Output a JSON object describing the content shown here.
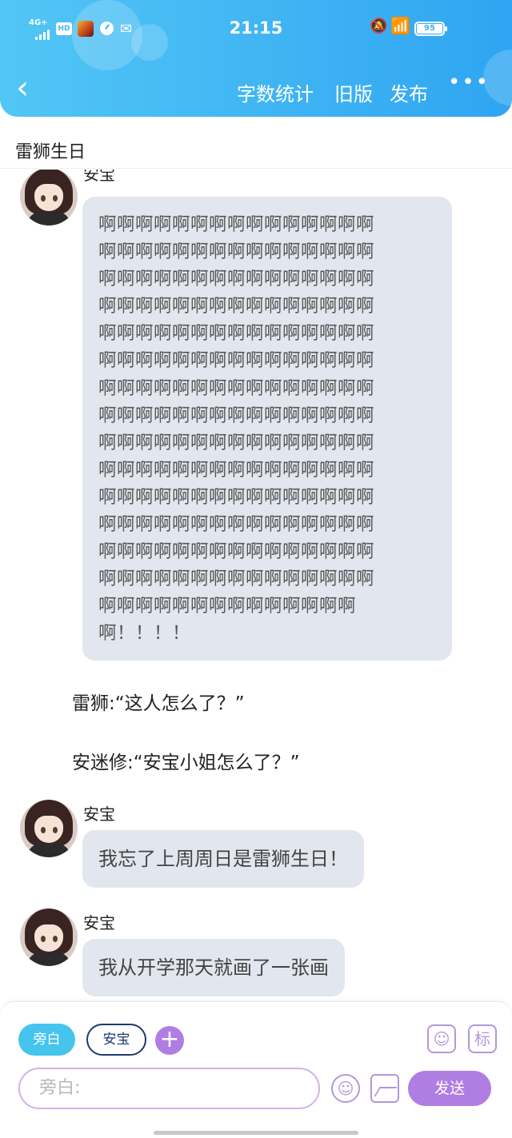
{
  "status_bar": {
    "network": "4G+",
    "hd": "HD",
    "time": "21:15",
    "battery": "95"
  },
  "toolbar": {
    "back_label": "‹",
    "word_count": "字数统计",
    "old_version": "旧版",
    "publish": "发布",
    "more": "•••"
  },
  "doc": {
    "title": "雷狮生日"
  },
  "messages": {
    "first": {
      "speaker": "安宝",
      "lines": [
        "啊啊啊啊啊啊啊啊啊啊啊啊啊啊啊",
        "啊啊啊啊啊啊啊啊啊啊啊啊啊啊啊",
        "啊啊啊啊啊啊啊啊啊啊啊啊啊啊啊",
        "啊啊啊啊啊啊啊啊啊啊啊啊啊啊啊",
        "啊啊啊啊啊啊啊啊啊啊啊啊啊啊啊",
        "啊啊啊啊啊啊啊啊啊啊啊啊啊啊啊",
        "啊啊啊啊啊啊啊啊啊啊啊啊啊啊啊",
        "啊啊啊啊啊啊啊啊啊啊啊啊啊啊啊",
        "啊啊啊啊啊啊啊啊啊啊啊啊啊啊啊",
        "啊啊啊啊啊啊啊啊啊啊啊啊啊啊啊",
        "啊啊啊啊啊啊啊啊啊啊啊啊啊啊啊",
        "啊啊啊啊啊啊啊啊啊啊啊啊啊啊啊",
        "啊啊啊啊啊啊啊啊啊啊啊啊啊啊啊",
        "啊啊啊啊啊啊啊啊啊啊啊啊啊啊啊",
        "啊啊啊啊啊啊啊啊啊啊啊啊啊啊",
        "啊！！！！"
      ]
    },
    "narration_1": "雷狮:“这人怎么了？”",
    "narration_2": "安迷修:“安宝小姐怎么了？”",
    "second": {
      "speaker": "安宝",
      "text": "我忘了上周周日是雷狮生日！"
    },
    "third": {
      "speaker": "安宝",
      "text": "我从开学那天就画了一张画"
    }
  },
  "composer": {
    "chip_narrator": "旁白",
    "chip_character": "安宝",
    "plus": "+",
    "tag_icon_label": "标",
    "input_placeholder": "旁白:",
    "send_label": "发送"
  },
  "colors": {
    "header_gradient_start": "#52c6f5",
    "header_gradient_end": "#2fa5f2",
    "accent_purple": "#b07ee2",
    "bubble_bg": "#e2e6ee",
    "chip_cyan": "#45c4ee"
  }
}
